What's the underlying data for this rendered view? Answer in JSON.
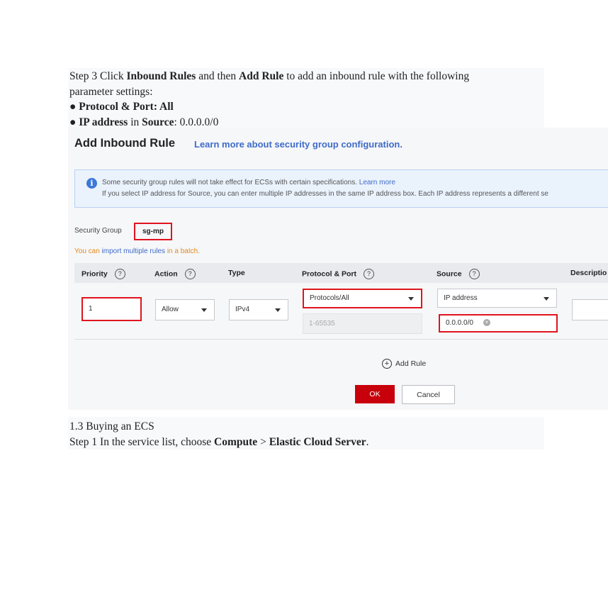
{
  "doc_top": {
    "step3_prefix": "Step 3 Click ",
    "step3_bold1": "Inbound Rules",
    "step3_mid": " and then ",
    "step3_bold2": "Add Rule",
    "step3_suffix": " to add an inbound rule with the following",
    "step3_line2": "parameter settings:",
    "bullet1_label": "Protocol & Port: All",
    "bullet2_bold": "IP address",
    "bullet2_mid": " in ",
    "bullet2_bold2": "Source",
    "bullet2_value": ": 0.0.0.0/0"
  },
  "dialog": {
    "title": "Add Inbound Rule",
    "title_link": "Learn more about security group configuration.",
    "info_line1": "Some security group rules will not take effect for ECSs with certain specifications.",
    "info_link": "Learn more",
    "info_line2": "If you select IP address for Source, you can enter multiple IP addresses in the same IP address box. Each IP address represents a different se",
    "security_group_label": "Security Group",
    "security_group_value": "sg-mp",
    "batch_prefix": "You can ",
    "batch_link": "import multiple rules",
    "batch_suffix": " in a batch.",
    "columns": {
      "priority": "Priority",
      "action": "Action",
      "type": "Type",
      "protocol_port": "Protocol & Port",
      "source": "Source",
      "description": "Descriptio"
    },
    "help_glyph": "?",
    "row": {
      "priority": "1",
      "action": "Allow",
      "type": "IPv4",
      "protocol": "Protocols/All",
      "port_placeholder": "1-65535",
      "source_type": "IP address",
      "source_value": "0.0.0.0/0"
    },
    "add_rule": "Add Rule",
    "ok": "OK",
    "cancel": "Cancel"
  },
  "doc_bottom": {
    "heading": "1.3 Buying an ECS",
    "step1_prefix": "Step 1 In the service list, choose ",
    "step1_bold1": "Compute",
    "step1_sep": " > ",
    "step1_bold2": "Elastic Cloud Server",
    "step1_suffix": "."
  },
  "colors": {
    "highlight_red": "#e0141e",
    "ok_button": "#c7000b",
    "link_blue": "#3f6bc8",
    "batch_orange": "#e08a1e"
  },
  "icons": [
    "info-icon",
    "help-icon",
    "chevron-down-icon",
    "clear-icon",
    "plus-circle-icon"
  ]
}
